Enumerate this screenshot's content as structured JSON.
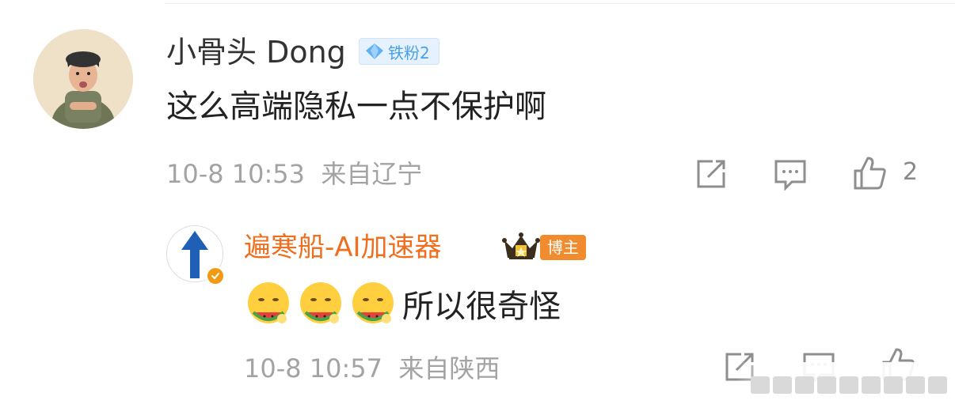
{
  "main_comment": {
    "username": "小骨头 Dong",
    "fan_badge": "铁粉2",
    "text": "这么高端隐私一点不保护啊",
    "timestamp": "10-8 10:53",
    "location": "来自辽宁",
    "like_count": "2"
  },
  "reply": {
    "username": "遍寒船-AI加速器",
    "role_badge": "博主",
    "text": "所以很奇怪",
    "emoji_count": 3,
    "timestamp": "10-8 10:57",
    "location": "来自陕西"
  },
  "icons": {
    "share": "share-icon",
    "comment": "comment-icon",
    "like": "thumbs-up-icon",
    "fan_diamond": "diamond-icon",
    "crown": "crown-icon",
    "verified": "verified-check-icon",
    "emoji": "watermelon-eating-emoji"
  },
  "colors": {
    "username_reply": "#ee6f1f",
    "fan_badge_text": "#4b9ee8",
    "host_badge_bg": "#f08c2d",
    "meta_text": "#a3a3a3",
    "verified_badge": "#f29a13"
  }
}
